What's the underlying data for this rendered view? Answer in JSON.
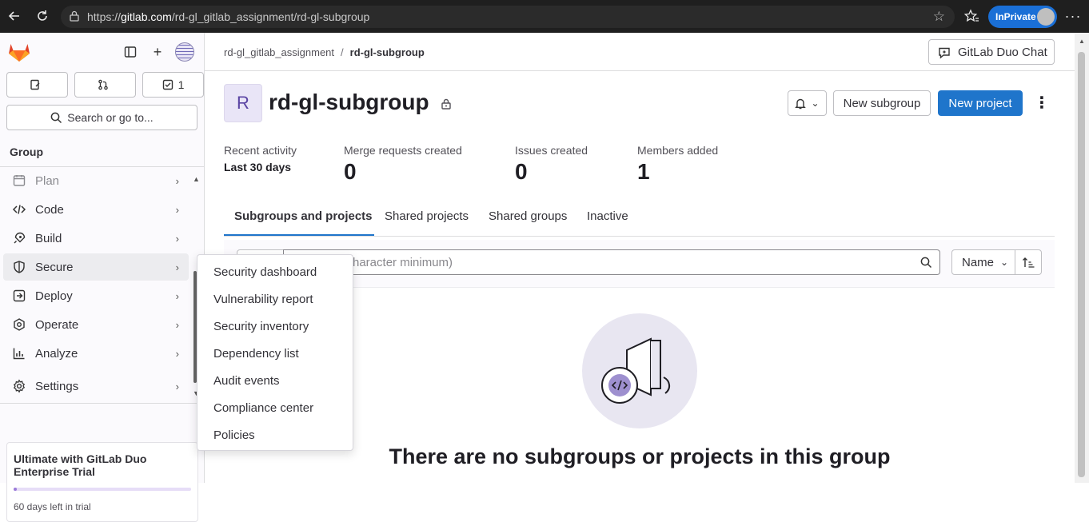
{
  "browser": {
    "url_prefix": "https://",
    "url_host": "gitlab.com",
    "url_path": "/rd-gl_gitlab_assignment/rd-gl-subgroup",
    "inprivate_label": "InPrivate"
  },
  "sidebar": {
    "counters": [
      {
        "icon": "issues-icon",
        "value": ""
      },
      {
        "icon": "merge-request-icon",
        "value": ""
      },
      {
        "icon": "todo-icon",
        "value": "1"
      }
    ],
    "search_label": "Search or go to...",
    "section_label": "Group",
    "items": [
      {
        "label": "Plan",
        "icon": "plan-icon"
      },
      {
        "label": "Code",
        "icon": "code-icon"
      },
      {
        "label": "Build",
        "icon": "rocket-icon"
      },
      {
        "label": "Secure",
        "icon": "shield-icon"
      },
      {
        "label": "Deploy",
        "icon": "deploy-icon"
      },
      {
        "label": "Operate",
        "icon": "operate-icon"
      },
      {
        "label": "Analyze",
        "icon": "chart-icon"
      },
      {
        "label": "Settings",
        "icon": "gear-icon"
      }
    ],
    "trial": {
      "title": "Ultimate with GitLab Duo Enterprise Trial",
      "days_left": "60 days left in trial",
      "progress": 0.02
    }
  },
  "flyout": {
    "items": [
      "Security dashboard",
      "Vulnerability report",
      "Security inventory",
      "Dependency list",
      "Audit events",
      "Compliance center",
      "Policies"
    ]
  },
  "header": {
    "breadcrumb_parent": "rd-gl_gitlab_assignment",
    "breadcrumb_separator": "/",
    "breadcrumb_current": "rd-gl-subgroup",
    "duo_chat_label": "GitLab Duo Chat"
  },
  "group": {
    "avatar_letter": "R",
    "title": "rd-gl-subgroup",
    "new_subgroup_label": "New subgroup",
    "new_project_label": "New project"
  },
  "stats": {
    "recent_activity_label": "Recent activity",
    "recent_activity_value": "Last 30 days",
    "merge_requests_label": "Merge requests created",
    "merge_requests_value": "0",
    "issues_label": "Issues created",
    "issues_value": "0",
    "members_label": "Members added",
    "members_value": "1"
  },
  "tabs": [
    "Subgroups and projects",
    "Shared projects",
    "Shared groups",
    "Inactive"
  ],
  "filter": {
    "placeholder_visible": "haracter minimum)",
    "sort_label": "Name"
  },
  "empty_state": {
    "title": "There are no subgroups or projects in this group"
  },
  "colors": {
    "primary_button": "#1f75cb",
    "sidebar_bg": "#fbfafd",
    "accent_purple": "#5943a3"
  }
}
